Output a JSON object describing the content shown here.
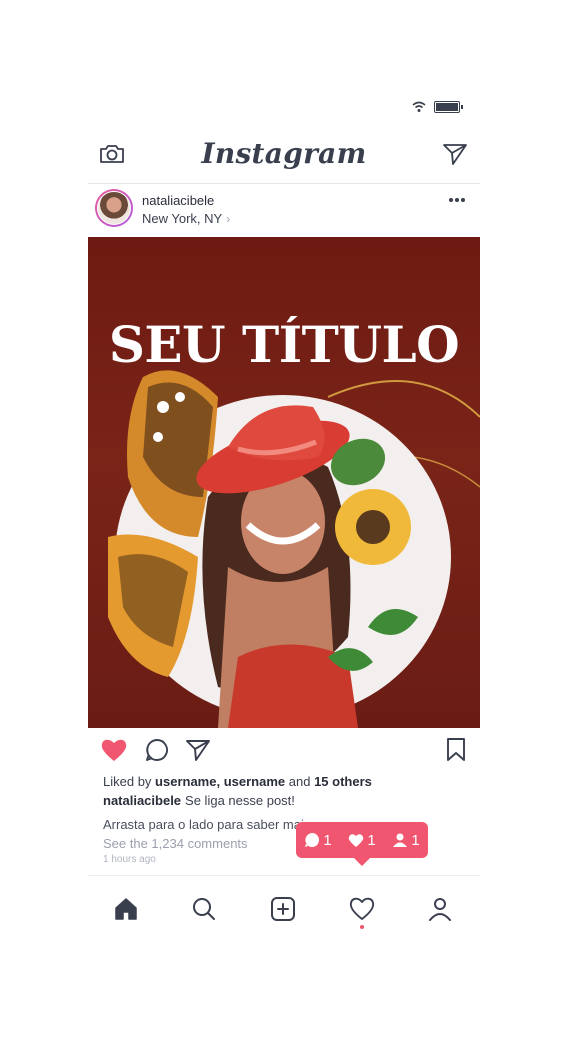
{
  "app": {
    "brand": "Instagram"
  },
  "post": {
    "username": "nataliacibele",
    "location": "New York, NY",
    "location_chevron": "›",
    "title": "SEU TÍTULO",
    "liked_by_prefix": "Liked by",
    "liked_by_users": "username, username",
    "liked_by_and": "and",
    "liked_by_others": "15 others",
    "caption_user": "nataliacibele",
    "caption_text": "Se liga nesse post!",
    "extra_text": "Arrasta para o lado para saber mais",
    "comments_link": "See the 1,234 comments",
    "time": "1 hours ago",
    "liked": true
  },
  "notification": {
    "comments": "1",
    "likes": "1",
    "follows": "1"
  },
  "icons": {
    "camera": "camera-icon",
    "direct": "send-icon",
    "more": "more-icon",
    "like": "heart-icon",
    "comment": "comment-icon",
    "share": "share-icon",
    "save": "bookmark-icon",
    "home": "home-icon",
    "search": "search-icon",
    "add": "add-icon",
    "activity": "heart-outline-icon",
    "profile": "profile-icon"
  },
  "colors": {
    "accent": "#f0566f",
    "ink": "#3a3f4e",
    "post_bg": "#6e1a12"
  }
}
